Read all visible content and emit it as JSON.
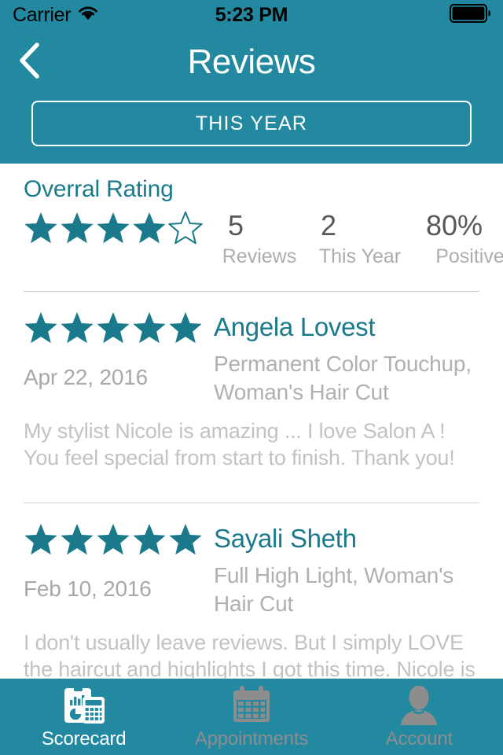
{
  "statusbar": {
    "carrier": "Carrier",
    "wifi_icon": "wifi-icon",
    "time": "5:23 PM",
    "battery_icon": "battery-full-icon"
  },
  "navbar": {
    "back_icon": "chevron-left-icon",
    "title": "Reviews"
  },
  "filter": {
    "label": "THIS YEAR"
  },
  "summary": {
    "title": "Overral Rating",
    "rating": 4,
    "max_rating": 5,
    "stats": [
      {
        "value": "5",
        "label": "Reviews"
      },
      {
        "value": "2",
        "label": "This Year"
      },
      {
        "value": "80%",
        "label": "Positive"
      }
    ]
  },
  "reviews": [
    {
      "rating": 5,
      "date": "Apr 22, 2016",
      "name": "Angela Lovest",
      "services": "Permanent Color Touchup, Woman's Hair Cut",
      "body": "My stylist Nicole is amazing ... I love Salon A ! You feel special from start to finish. Thank you!"
    },
    {
      "rating": 5,
      "date": "Feb 10, 2016",
      "name": "Sayali Sheth",
      "services": "Full High Light, Woman's Hair Cut",
      "body": "I don't usually leave reviews. But I simply LOVE the haircut and highlights I got this time. Nicole is so cool"
    }
  ],
  "tabbar": {
    "tabs": [
      {
        "label": "Scorecard",
        "icon": "scorecard-icon",
        "active": true
      },
      {
        "label": "Appointments",
        "icon": "calendar-icon",
        "active": false
      },
      {
        "label": "Account",
        "icon": "person-icon",
        "active": false
      }
    ]
  },
  "colors": {
    "teal": "#2389a0",
    "teal_text": "#1a7a8c",
    "star_filled": "#1a7a8c",
    "gray_value": "#585858",
    "gray_label": "#adadad",
    "gray_body": "#c2c2c2",
    "tab_inactive": "#8d8d8d"
  }
}
